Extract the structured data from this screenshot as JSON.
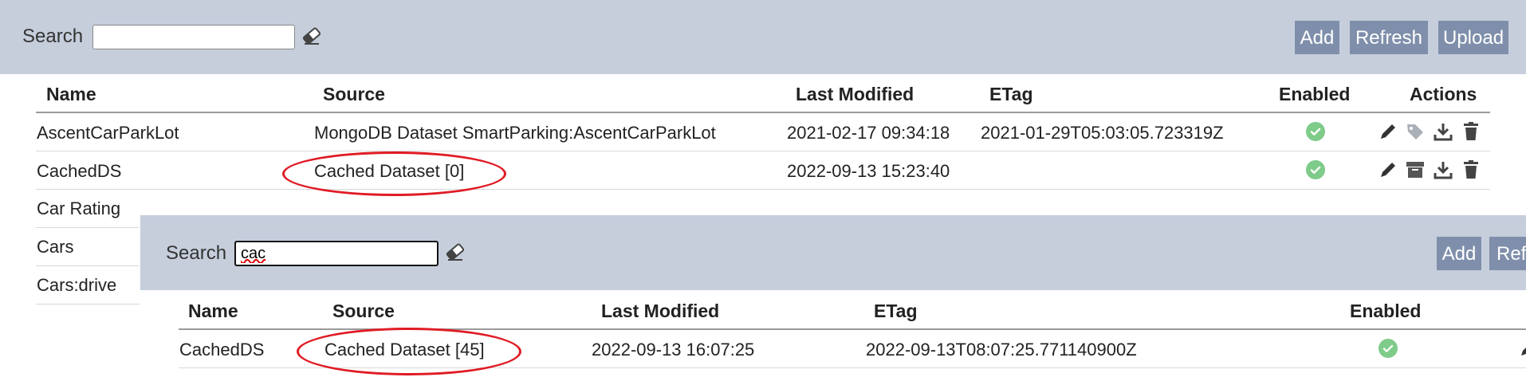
{
  "back": {
    "search_label": "Search",
    "search_value": "",
    "buttons": {
      "add": "Add",
      "refresh": "Refresh",
      "upload": "Upload"
    },
    "columns": {
      "name": "Name",
      "source": "Source",
      "last_modified": "Last Modified",
      "etag": "ETag",
      "enabled": "Enabled",
      "actions": "Actions"
    },
    "rows": [
      {
        "name": "AscentCarParkLot",
        "source": "MongoDB Dataset SmartParking:AscentCarParkLot",
        "last_modified": "2021-02-17 09:34:18",
        "etag": "2021-01-29T05:03:05.723319Z",
        "enabled": true
      },
      {
        "name": "CachedDS",
        "source": "Cached Dataset [0]",
        "last_modified": "2022-09-13 15:23:40",
        "etag": "",
        "enabled": true
      },
      {
        "name": "Car Rating"
      },
      {
        "name": "Cars"
      },
      {
        "name": "Cars:drive"
      }
    ]
  },
  "front": {
    "search_label": "Search",
    "search_value": "cac",
    "buttons": {
      "add": "Add",
      "refresh": "Ref"
    },
    "columns": {
      "name": "Name",
      "source": "Source",
      "last_modified": "Last Modified",
      "etag": "ETag",
      "enabled": "Enabled"
    },
    "rows": [
      {
        "name": "CachedDS",
        "source": "Cached Dataset [45]",
        "last_modified": "2022-09-13 16:07:25",
        "etag": "2022-09-13T08:07:25.771140900Z",
        "enabled": true
      }
    ]
  },
  "colors": {
    "toolbar": "#c6cedc",
    "button": "#7f8fab",
    "enabled": "#7fcb8a",
    "highlight": "#e01b24",
    "action_icon": "#333333"
  }
}
